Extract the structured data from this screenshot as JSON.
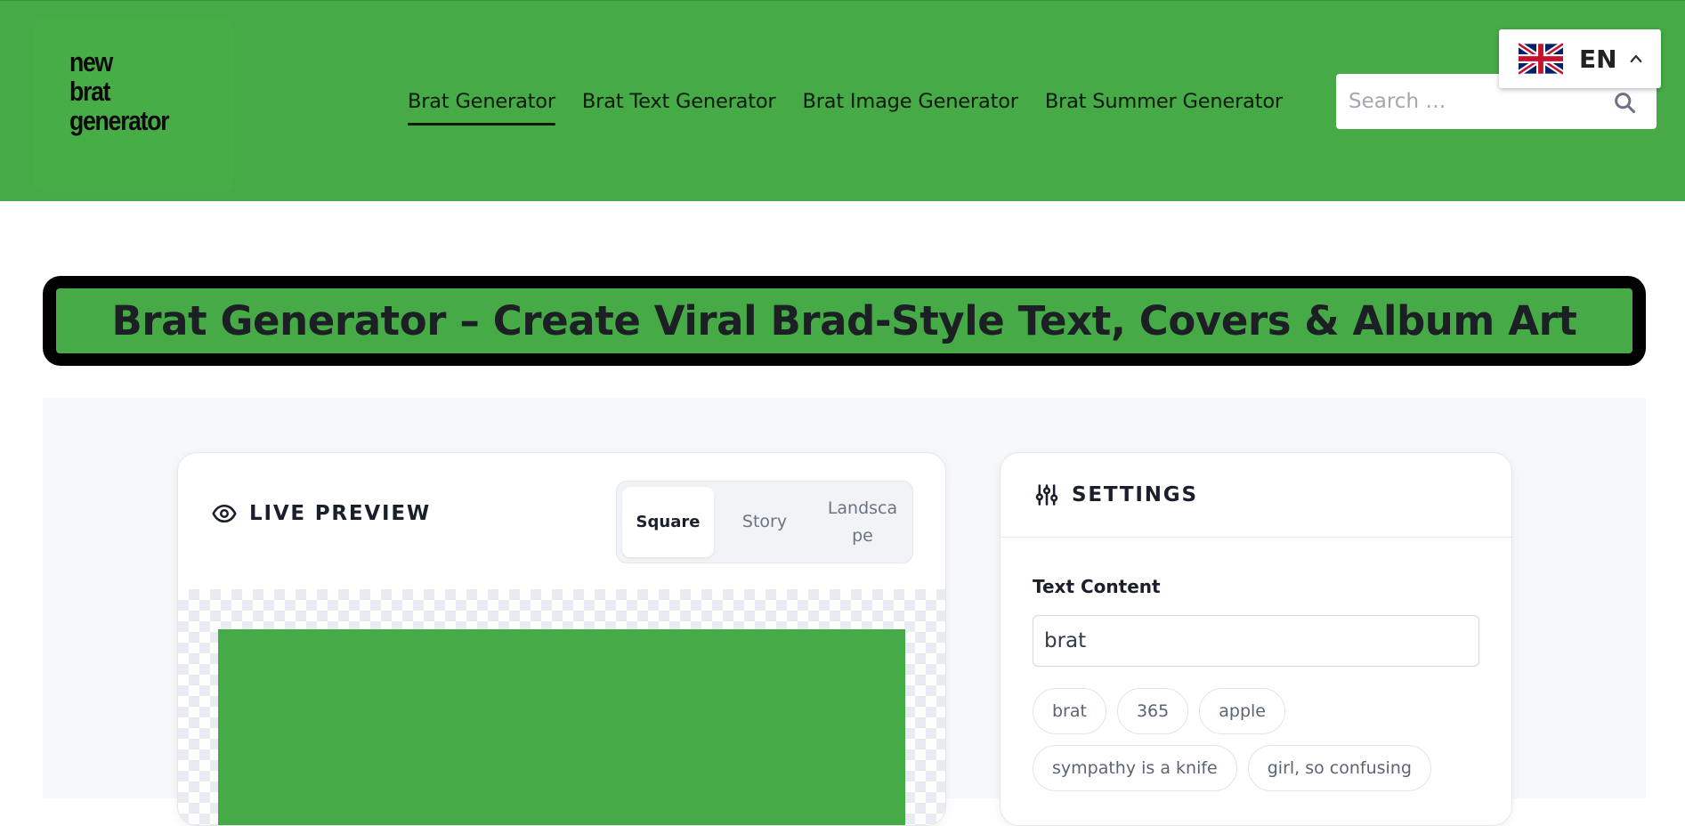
{
  "header": {
    "logo_lines": [
      "new",
      "brat",
      "generator"
    ],
    "nav": [
      {
        "label": "Brat Generator",
        "active": true
      },
      {
        "label": "Brat Text Generator",
        "active": false
      },
      {
        "label": "Brat Image Generator",
        "active": false
      },
      {
        "label": "Brat Summer Generator",
        "active": false
      }
    ],
    "search": {
      "placeholder": "Search …",
      "icon": "search-icon"
    },
    "language": {
      "label": "EN",
      "flag": "uk-flag-icon",
      "icon": "chevron-up-icon"
    }
  },
  "banner": {
    "title": "Brat Generator – Create Viral Brad-Style Text, Covers & Album Art"
  },
  "preview": {
    "title": "LIVE PREVIEW",
    "icon": "eye-icon",
    "formats": [
      "Square",
      "Story",
      "Landscape"
    ],
    "selected_format": "Square"
  },
  "settings": {
    "title": "SETTINGS",
    "icon": "sliders-icon",
    "text_label": "Text Content",
    "text_value": "brat",
    "presets": [
      "brat",
      "365",
      "apple",
      "sympathy is a knife",
      "girl, so confusing"
    ]
  },
  "colors": {
    "brand_green": "#46ab46",
    "text_dark": "#1a1f2b",
    "muted": "#6b7482"
  }
}
